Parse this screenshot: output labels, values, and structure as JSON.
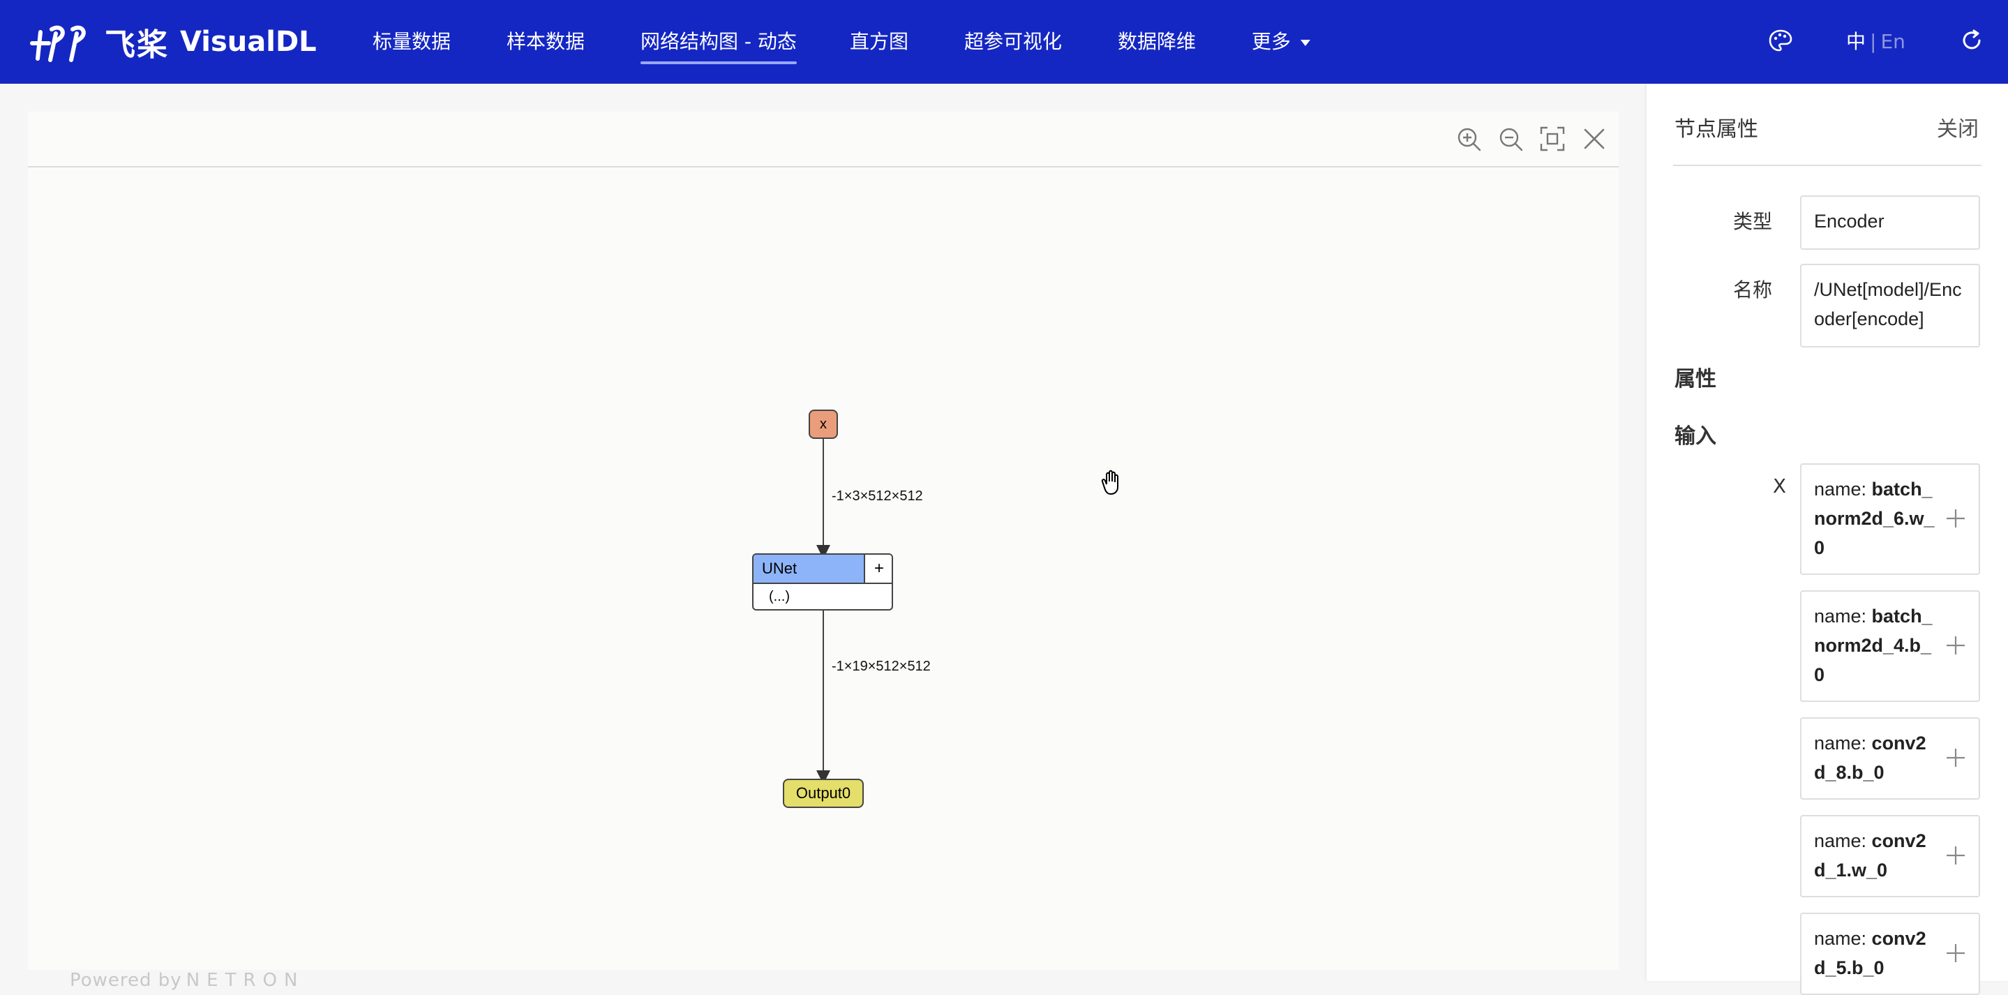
{
  "header": {
    "brand_cn": "飞桨",
    "brand_en": "VisualDL",
    "nav": [
      {
        "label": "标量数据"
      },
      {
        "label": "样本数据"
      },
      {
        "label": "网络结构图 - 动态",
        "active": true
      },
      {
        "label": "直方图"
      },
      {
        "label": "超参可视化"
      },
      {
        "label": "数据降维"
      },
      {
        "label": "更多"
      }
    ],
    "lang_zh": "中",
    "lang_sep": "|",
    "lang_en": "En",
    "colors": {
      "bar": "#1527c2",
      "text": "#ffffff"
    },
    "icons": [
      "palette-icon",
      "refresh-icon",
      "chevron-down-icon"
    ]
  },
  "graph": {
    "toolbar_icons": [
      "zoom-in-icon",
      "zoom-out-icon",
      "fit-screen-icon",
      "close-icon"
    ],
    "nodes": {
      "input": "x",
      "model": "UNet",
      "model_expand": "+",
      "model_attrs": "(...)",
      "output": "Output0"
    },
    "edges": [
      {
        "label": "-1×3×512×512"
      },
      {
        "label": "-1×19×512×512"
      }
    ],
    "powered_by": "Powered by",
    "netron": "NETRON"
  },
  "sidebar": {
    "title": "节点属性",
    "close_label": "关闭",
    "type_label": "类型",
    "type_value": "Encoder",
    "name_label": "名称",
    "name_value": "/UNet[model]/Encoder[encode]",
    "attributes_title": "属性",
    "inputs_title": "输入",
    "input_name": "X",
    "input_prefix": "name: ",
    "inputs": [
      {
        "value": "batch_norm2d_6.w_0"
      },
      {
        "value": "batch_norm2d_4.b_0"
      },
      {
        "value": "conv2d_8.b_0"
      },
      {
        "value": "conv2d_1.w_0"
      },
      {
        "value": "conv2d_5.b_0"
      }
    ]
  }
}
